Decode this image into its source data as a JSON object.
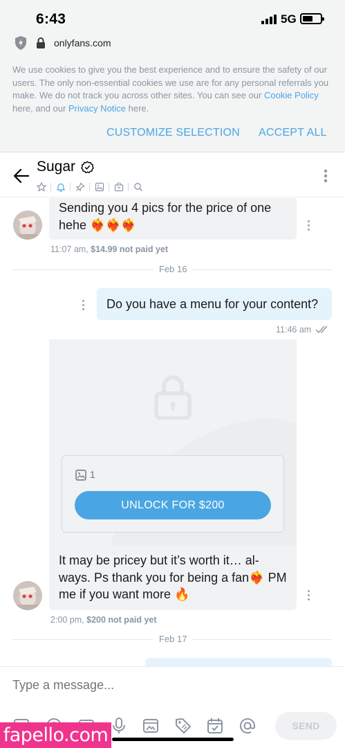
{
  "status_bar": {
    "time": "6:43",
    "network": "5G"
  },
  "browser": {
    "url": "onlyfans.com"
  },
  "cookie_banner": {
    "text_before_cookie_link": "We use cookies to give you the best experience and to ensure the safety of our users. The only non-essential cookies we use are for any personal referrals you make. We do not track you across other sites. You can see our ",
    "cookie_link": "Cookie Policy",
    "text_middle": " here, and our ",
    "privacy_link": "Privacy Notice",
    "text_after": " here.",
    "customize_label": "CUSTOMIZE SELECTION",
    "accept_label": "ACCEPT ALL"
  },
  "chat_header": {
    "name": "Sugar",
    "icons": [
      "star-icon",
      "bell-icon",
      "pin-icon",
      "image-icon",
      "bag-icon",
      "search-icon"
    ]
  },
  "messages": [
    {
      "direction": "incoming",
      "text": "Sending you 4 pics for the price of one hehe ❤️‍🔥❤️‍🔥❤️‍🔥",
      "time": "11:07 am,",
      "price_status": "$14.99 not paid yet"
    },
    {
      "type": "date_divider",
      "label": "Feb 16"
    },
    {
      "direction": "outgoing",
      "text": "Do you have a menu for your content?",
      "time": "11:46 am"
    },
    {
      "direction": "incoming",
      "locked_media_count": "1",
      "unlock_label": "UNLOCK FOR $200",
      "text": "It may be pricey but it’s worth it… al-ways. Ps thank you for being a fan❤️‍🔥 PM me if you want more 🔥",
      "time": "2:00 pm,",
      "price_status": "$200 not paid yet"
    },
    {
      "type": "date_divider",
      "label": "Feb 17"
    }
  ],
  "composer": {
    "placeholder": "Type a message...",
    "send_label": "SEND",
    "tools": [
      "image-icon",
      "dollar-icon",
      "media-icon",
      "microphone-icon",
      "vault-icon",
      "tag-icon",
      "calendar-icon",
      "at-icon"
    ]
  },
  "watermark": "fapello.com",
  "colors": {
    "accent": "#4aa6e3",
    "meta": "#8a96a3",
    "incoming_bubble": "#f1f2f4",
    "outgoing_bubble": "#e5f3fd",
    "watermark": "#f0348e"
  }
}
